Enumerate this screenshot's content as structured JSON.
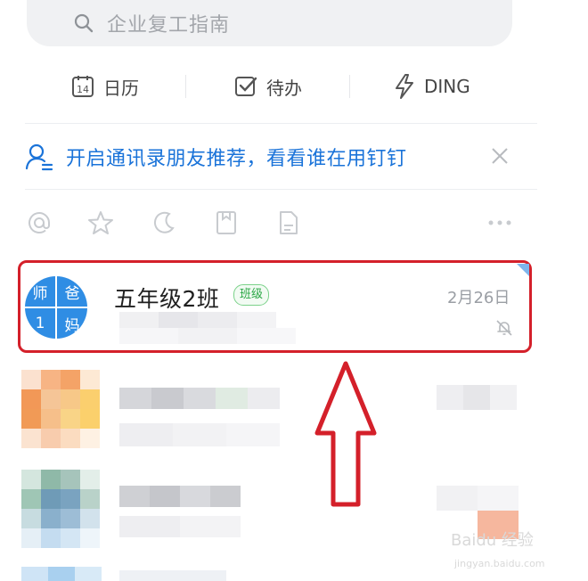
{
  "search": {
    "placeholder": "企业复工指南",
    "icon": "search-icon"
  },
  "quick_actions": [
    {
      "label": "日历",
      "icon": "calendar-icon",
      "badge": "14"
    },
    {
      "label": "待办",
      "icon": "checkbox-icon"
    },
    {
      "label": "DING",
      "icon": "lightning-icon"
    }
  ],
  "banner": {
    "text": "开启通讯录朋友推荐，看看谁在用钉钉",
    "icon": "contact-icon"
  },
  "filters": [
    "at-icon",
    "star-icon",
    "moon-icon",
    "bookmark-icon",
    "file-icon",
    "more-icon"
  ],
  "chat": {
    "title": "五年级2班",
    "tag": "班级",
    "date": "2月26日",
    "avatar": {
      "q1": "师",
      "q2": "爸",
      "q3": "1",
      "q4": "妈"
    }
  },
  "colors": {
    "accent": "#1a73d9",
    "highlight": "#d4202a",
    "avatar": "#2f8de4",
    "tag": "#2aa745"
  },
  "watermark": {
    "brand": "Baidu 经验",
    "url": "jingyan.baidu.com"
  }
}
